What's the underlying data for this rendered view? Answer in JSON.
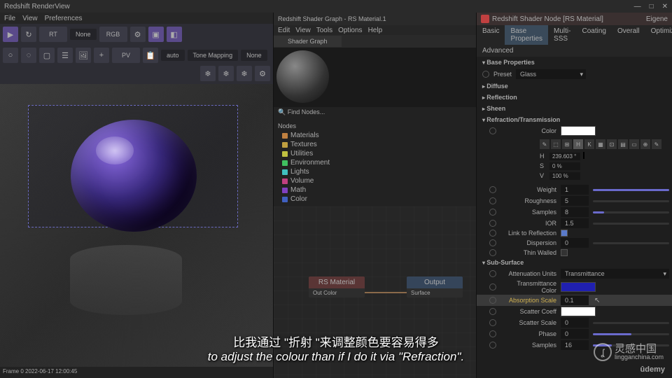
{
  "app": {
    "title": "Redshift RenderView"
  },
  "win_controls": [
    "—",
    "□",
    "✕"
  ],
  "menus": {
    "file": "File",
    "view": "View",
    "preferences": "Preferences"
  },
  "toolbar": {
    "refresh": "↻",
    "rt": "RT",
    "dropdown1": "None",
    "rgb": "RGB",
    "gear": "⚙",
    "crop": "▣",
    "snow1": "❄",
    "snow2": "❄",
    "snow3": "❄",
    "circle": "○",
    "dashed": "◌",
    "focus": "▢",
    "layers": "☰",
    "img1": "🖼",
    "plus": "+",
    "pv": "PV",
    "copy": "📋",
    "d1": "auto",
    "d2": "Tone Mapping",
    "d3": "None"
  },
  "statusbar": "Frame 0  2022-06-17  12:00:45",
  "shader": {
    "title": "Redshift Shader Graph - RS Material.1",
    "menu": {
      "edit": "Edit",
      "view": "View",
      "tools": "Tools",
      "options": "Options",
      "help": "Help"
    },
    "tab": "Shader Graph",
    "search": "🔍 Find Nodes...",
    "nodes_hdr": "Nodes",
    "categories": [
      {
        "name": "Materials",
        "color": "#c08040"
      },
      {
        "name": "Textures",
        "color": "#c0a040"
      },
      {
        "name": "Utilities",
        "color": "#c0c040"
      },
      {
        "name": "Environment",
        "color": "#40c060"
      },
      {
        "name": "Lights",
        "color": "#40c0c0"
      },
      {
        "name": "Volume",
        "color": "#c04080"
      },
      {
        "name": "Math",
        "color": "#8040c0"
      },
      {
        "name": "Color",
        "color": "#4060c0"
      }
    ],
    "node1": {
      "title": "RS Material",
      "port": "Out Color"
    },
    "node2": {
      "title": "Output",
      "port": "Surface"
    }
  },
  "inspector": {
    "title": "Redshift Shader Node [RS Material]",
    "layer": "Eigene",
    "tabs": [
      "Basic",
      "Base Properties",
      "Multi-SSS",
      "Coating",
      "Overall",
      "Optimizations"
    ],
    "tabs2": [
      "Advanced"
    ],
    "active_tab": "Base Properties",
    "preset_label": "Preset",
    "preset_value": "Glass",
    "base_props": "Base Properties",
    "groups": {
      "diffuse": "Diffuse",
      "reflection": "Reflection",
      "sheen": "Sheen",
      "refraction": "Refraction/Transmission",
      "subsurface": "Sub-Surface"
    },
    "color_label": "Color",
    "color_modes": [
      "✎",
      "⬚",
      "⊞",
      "H",
      "K",
      "▦",
      "⊡",
      "▤",
      "▭",
      "⊕",
      "✎"
    ],
    "hsv": {
      "h_label": "H",
      "h": "239.603 °",
      "s_label": "S",
      "s": "0 %",
      "v_label": "V",
      "v": "100 %"
    },
    "props": {
      "weight": {
        "label": "Weight",
        "value": "1"
      },
      "roughness": {
        "label": "Roughness",
        "value": "5"
      },
      "samples": {
        "label": "Samples",
        "value": "8"
      },
      "ior": {
        "label": "IOR",
        "value": "1.5"
      },
      "link": {
        "label": "Link to Reflection",
        "checked": true
      },
      "dispersion": {
        "label": "Dispersion",
        "value": "0"
      },
      "thin": {
        "label": "Thin Walled",
        "checked": false
      },
      "att_units": {
        "label": "Attenuation Units",
        "value": "Transmittance"
      },
      "trans_color": {
        "label": "Transmittance Color",
        "color": "#2020b0"
      },
      "abs_scale": {
        "label": "Absorption Scale",
        "value": "0.1"
      },
      "scatter_coeff": {
        "label": "Scatter Coeff",
        "color": "#ffffff"
      },
      "scatter_scale": {
        "label": "Scatter Scale",
        "value": "0"
      },
      "phase": {
        "label": "Phase",
        "value": "0"
      },
      "samples2": {
        "label": "Samples",
        "value": "16"
      }
    }
  },
  "subtitle": {
    "cn": "比我通过 \"折射 \"来调整颜色要容易得多",
    "en": "to adjust the colour than if I do it via \"Refraction\"."
  },
  "watermark": {
    "cn": "灵感中国",
    "en": "lingganchina.com"
  },
  "udemy": "ûdemy"
}
